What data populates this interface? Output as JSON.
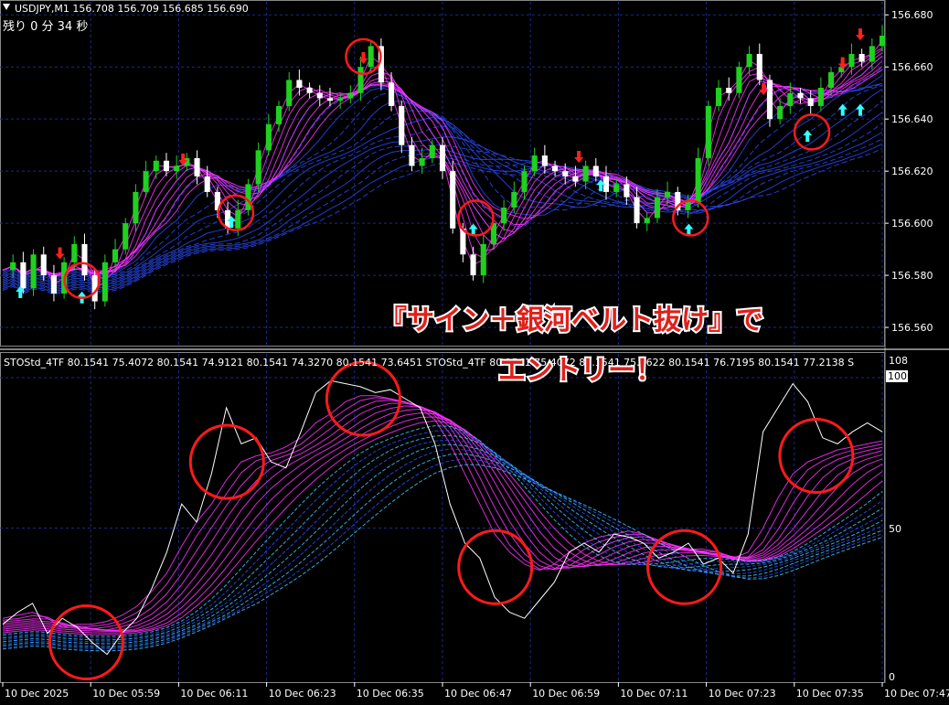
{
  "header": {
    "symbol_info": "USDJPY,M1  156.708 156.709 156.685 156.690",
    "timer": "残り 0 分 34 秒"
  },
  "indicator_header": {
    "text": "STOStd_4TF 80.1541 75.4072 80.1541 74.9121 80.1541 74.3270 80.1541 73.6451   STOStd_4TF 80.1541 75.4072 80.1541 75.2622 80.1541 76.7195 80.1541 77.2138  S"
  },
  "callout": {
    "line1": "『サイン＋銀河ベルト抜け』で",
    "line2": "エントリー！"
  },
  "colors": {
    "bull_candle": "#1fd11f",
    "bear_candle": "#ffffff",
    "grid": "#1a2a8a",
    "magenta_band": "#ff33ff",
    "blue_band": "#2a4cff",
    "cyan_band": "#3cc8ff",
    "up_arrow": "#33ffff",
    "down_arrow": "#ff2020",
    "circle": "#ff1a1a"
  },
  "chart_data": [
    {
      "type": "candlestick",
      "title": "USDJPY,M1",
      "y_ticks": [
        "156.680",
        "156.660",
        "156.640",
        "156.620",
        "156.600",
        "156.580",
        "156.560"
      ],
      "ylim": [
        156.553,
        156.685
      ],
      "price_series": [
        156.582,
        156.585,
        156.575,
        156.588,
        156.58,
        156.573,
        156.585,
        156.592,
        156.58,
        156.57,
        156.585,
        156.59,
        156.6,
        156.612,
        156.62,
        156.624,
        156.62,
        156.622,
        156.625,
        156.618,
        156.612,
        156.605,
        156.598,
        156.605,
        156.615,
        156.628,
        156.638,
        156.645,
        156.655,
        156.652,
        156.65,
        156.648,
        156.647,
        156.648,
        156.65,
        156.66,
        156.668,
        156.654,
        156.645,
        156.63,
        156.622,
        156.625,
        156.63,
        156.62,
        156.598,
        156.588,
        156.58,
        156.592,
        156.6,
        156.606,
        156.612,
        156.62,
        156.626,
        156.622,
        156.62,
        156.618,
        156.616,
        156.622,
        156.618,
        156.612,
        156.615,
        156.61,
        156.6,
        156.602,
        156.61,
        156.612,
        156.605,
        156.608,
        156.625,
        156.645,
        156.652,
        156.65,
        156.66,
        156.665,
        156.655,
        156.64,
        156.645,
        156.65,
        156.648,
        156.645,
        156.652,
        156.658,
        156.66,
        156.665,
        156.662,
        156.668,
        156.672
      ],
      "up_arrows": [
        {
          "t": 0.02,
          "price": 156.573
        },
        {
          "t": 0.09,
          "price": 156.571
        },
        {
          "t": 0.26,
          "price": 156.6
        },
        {
          "t": 0.535,
          "price": 156.597
        },
        {
          "t": 0.68,
          "price": 156.614
        },
        {
          "t": 0.78,
          "price": 156.597
        },
        {
          "t": 0.915,
          "price": 156.633
        },
        {
          "t": 0.955,
          "price": 156.643
        },
        {
          "t": 0.975,
          "price": 156.643
        }
      ],
      "down_arrows": [
        {
          "t": 0.065,
          "price": 156.589
        },
        {
          "t": 0.205,
          "price": 156.625
        },
        {
          "t": 0.41,
          "price": 156.664
        },
        {
          "t": 0.655,
          "price": 156.626
        },
        {
          "t": 0.865,
          "price": 156.652
        },
        {
          "t": 0.955,
          "price": 156.662
        },
        {
          "t": 0.975,
          "price": 156.673
        }
      ],
      "highlights": [
        {
          "t": 0.09,
          "price": 156.578
        },
        {
          "t": 0.265,
          "price": 156.604
        },
        {
          "t": 0.41,
          "price": 156.664
        },
        {
          "t": 0.538,
          "price": 156.602
        },
        {
          "t": 0.782,
          "price": 156.602
        },
        {
          "t": 0.92,
          "price": 156.635
        }
      ]
    },
    {
      "type": "line",
      "title": "STOStd_4TF",
      "ylim": [
        0,
        100
      ],
      "y_ticks": [
        "100",
        "50",
        "0"
      ],
      "top_label": "108",
      "fast_line": [
        18,
        22,
        25,
        15,
        20,
        17,
        12,
        8,
        15,
        20,
        30,
        42,
        58,
        52,
        68,
        90,
        78,
        80,
        72,
        70,
        82,
        95,
        99,
        98,
        97,
        95,
        96,
        93,
        90,
        78,
        58,
        45,
        40,
        27,
        22,
        20,
        26,
        32,
        42,
        45,
        42,
        48,
        47,
        45,
        40,
        42,
        45,
        38,
        40,
        35,
        48,
        82,
        90,
        98,
        92,
        80,
        78,
        82,
        85,
        82
      ],
      "slow_line": [
        20,
        21,
        22,
        20,
        17,
        18,
        18,
        19,
        21,
        24,
        29,
        35,
        44,
        52,
        58,
        66,
        72,
        74,
        75,
        77,
        80,
        85,
        88,
        92,
        94,
        94,
        93,
        92,
        90,
        86,
        78,
        68,
        58,
        48,
        42,
        38,
        36,
        38,
        42,
        45,
        47,
        48,
        49,
        48,
        45,
        43,
        43,
        43,
        42,
        40,
        42,
        50,
        60,
        68,
        72,
        74,
        76,
        77,
        78,
        79
      ],
      "highlights": [
        {
          "t": 0.095,
          "value": 12
        },
        {
          "t": 0.255,
          "value": 72
        },
        {
          "t": 0.41,
          "value": 93
        },
        {
          "t": 0.56,
          "value": 37
        },
        {
          "t": 0.775,
          "value": 37
        },
        {
          "t": 0.925,
          "value": 74
        }
      ]
    }
  ],
  "time_axis": {
    "labels": [
      "10 Dec 2025",
      "10 Dec 05:59",
      "10 Dec 06:11",
      "10 Dec 06:23",
      "10 Dec 06:35",
      "10 Dec 06:47",
      "10 Dec 06:59",
      "10 Dec 07:11",
      "10 Dec 07:23",
      "10 Dec 07:35",
      "10 Dec 07:47"
    ]
  }
}
